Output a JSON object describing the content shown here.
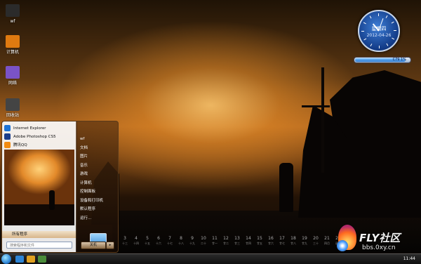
{
  "desktop_icons": [
    {
      "label": "wf",
      "color": "#2b2b2b",
      "icon": "folder-icon"
    },
    {
      "label": "计算机",
      "color": "#e07a10",
      "icon": "computer-icon"
    },
    {
      "label": "网络",
      "color": "#7a53c7",
      "icon": "network-icon"
    },
    {
      "label": "回收站",
      "color": "#444444",
      "icon": "recycle-bin-icon"
    }
  ],
  "gadget": {
    "weekday": "星期四",
    "date": "2012-04-26",
    "meter_text": "C79 1%",
    "meter_value": 0.92
  },
  "start_menu": {
    "pinned": [
      {
        "label": "Internet Explorer",
        "color": "#1d74d8",
        "icon": "ie-icon"
      },
      {
        "label": "Adobe Photoshop CS5",
        "color": "#1b3e8c",
        "icon": "photoshop-icon"
      },
      {
        "label": "腾讯QQ",
        "color": "#f28b12",
        "icon": "qq-icon"
      }
    ],
    "all_programs": "所有程序",
    "search_placeholder": "搜索程序和文件",
    "right_items": [
      "wf",
      "文档",
      "图片",
      "音乐",
      "游戏",
      "计算机",
      "控制面板",
      "设备和打印机",
      "默认程序",
      "运行..."
    ],
    "shutdown": "关机"
  },
  "calendar": [
    {
      "n": "3",
      "w": "十三"
    },
    {
      "n": "4",
      "w": "十四"
    },
    {
      "n": "5",
      "w": "十五"
    },
    {
      "n": "6",
      "w": "十六"
    },
    {
      "n": "7",
      "w": "十七"
    },
    {
      "n": "8",
      "w": "十八"
    },
    {
      "n": "9",
      "w": "十九"
    },
    {
      "n": "10",
      "w": "二十"
    },
    {
      "n": "11",
      "w": "廿一"
    },
    {
      "n": "12",
      "w": "廿二"
    },
    {
      "n": "13",
      "w": "廿三"
    },
    {
      "n": "14",
      "w": "廿四"
    },
    {
      "n": "15",
      "w": "廿五"
    },
    {
      "n": "16",
      "w": "廿六"
    },
    {
      "n": "17",
      "w": "廿七"
    },
    {
      "n": "18",
      "w": "廿八"
    },
    {
      "n": "19",
      "w": "廿九"
    },
    {
      "n": "20",
      "w": "三十"
    },
    {
      "n": "21",
      "w": "四月"
    },
    {
      "n": "22",
      "w": "初二"
    }
  ],
  "watermark": {
    "brand": "FLY社区",
    "url": "bbs.0xy.cn"
  },
  "taskbar": {
    "clock": "11:44",
    "buttons": [
      {
        "color": "#2e85d6",
        "icon": "ie-taskbar-icon"
      },
      {
        "color": "#e0a020",
        "icon": "explorer-taskbar-icon"
      },
      {
        "color": "#4a8c3a",
        "icon": "media-taskbar-icon"
      }
    ]
  }
}
